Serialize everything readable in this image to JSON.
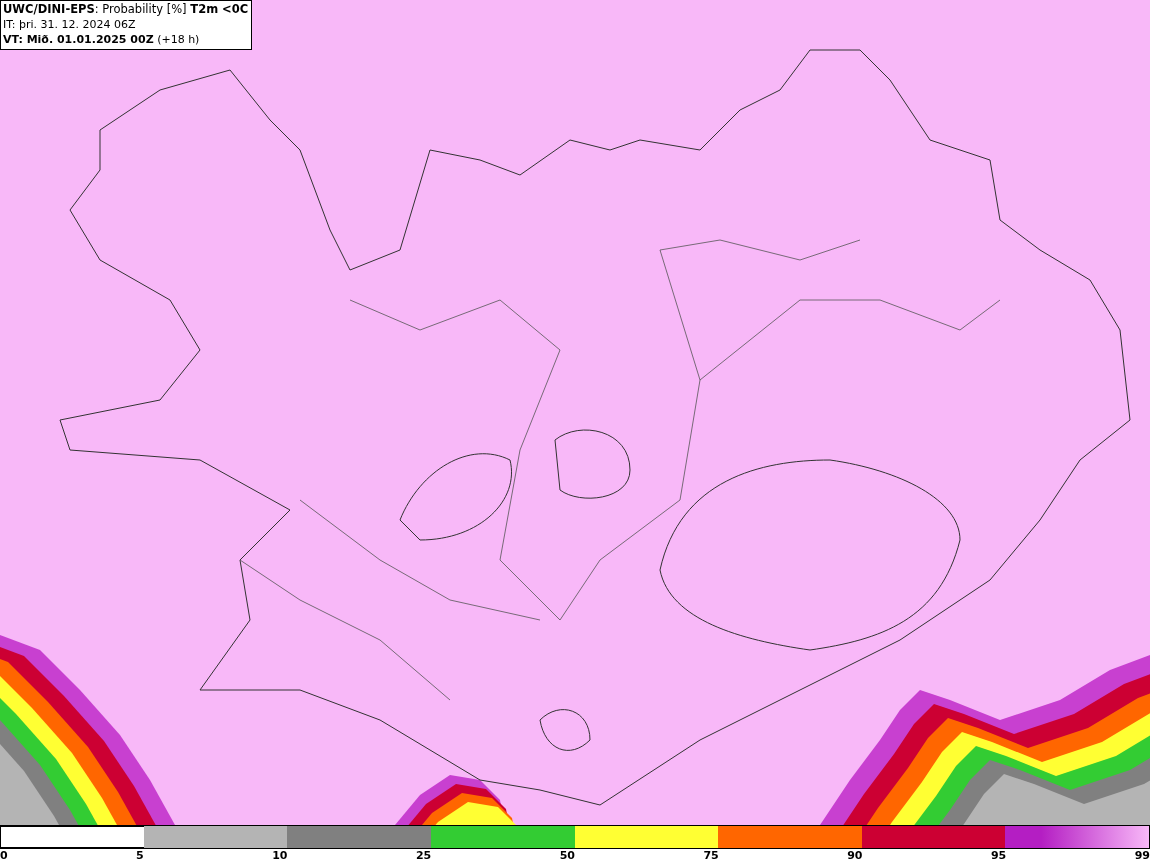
{
  "header": {
    "title": "**UWC/DINI-EPS**: Probability [%] **T2m <0C**",
    "issue_time": "IT: þri. 31. 12. 2024 06Z",
    "valid_time": "**VT: Mið. 01.01.2025 00Z** (+18 h)"
  },
  "legend": {
    "start_label": "0",
    "bins": [
      {
        "color": "#ffffff",
        "label": "5"
      },
      {
        "color": "#b4b4b4",
        "label": "10"
      },
      {
        "color": "#808080",
        "label": "25"
      },
      {
        "color": "#33cc33",
        "label": "50"
      },
      {
        "color": "#ffff33",
        "label": "75"
      },
      {
        "color": "#ff6600",
        "label": "90"
      },
      {
        "color": "#cc0033",
        "label": "95"
      },
      {
        "color": "#b41ec3",
        "kind": "gradient",
        "label": "99"
      }
    ]
  }
}
